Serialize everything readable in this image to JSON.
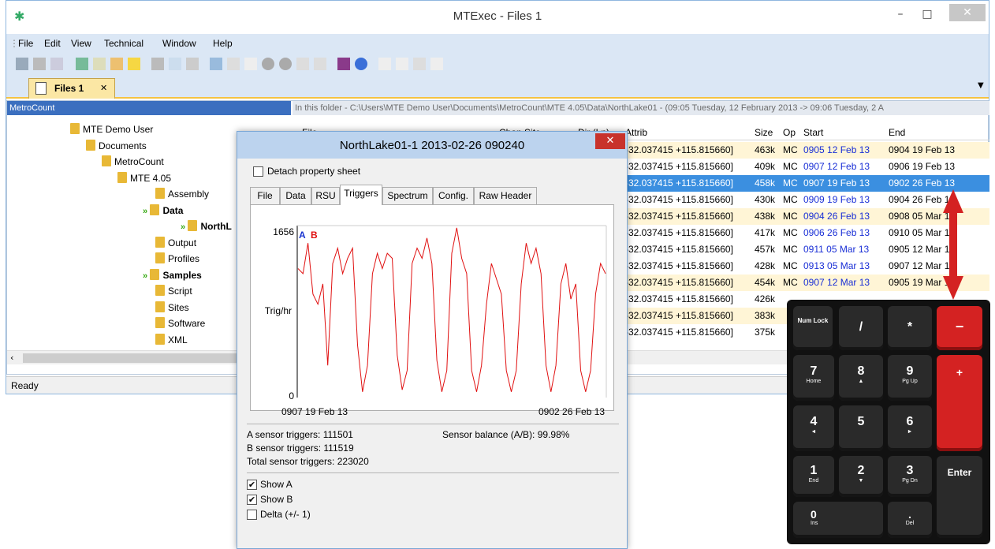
{
  "window": {
    "title": "MTExec - Files 1",
    "min": "–",
    "max": "□",
    "close": "✕"
  },
  "menu": [
    "File",
    "Edit",
    "View",
    "Technical",
    "Window",
    "Help"
  ],
  "tab": {
    "label": "Files 1",
    "close": "✕"
  },
  "tree": {
    "header": "MetroCount",
    "nodes": [
      "MTE Demo User",
      "Documents",
      "MetroCount",
      "MTE 4.05",
      "Assembly",
      "Data",
      "NorthL",
      "Output",
      "Profiles",
      "Samples",
      "Script",
      "Sites",
      "Software",
      "XML"
    ]
  },
  "list": {
    "path": "In this folder - C:\\Users\\MTE Demo User\\Documents\\MetroCount\\MTE 4.05\\Data\\NorthLake01 - (09:05 Tuesday, 12 February 2013 -> 09:06 Tuesday, 2 A",
    "columns": [
      "File",
      "Chan Site",
      "Dir (Ln)",
      "Attrib",
      "Size",
      "Op",
      "Start",
      "End"
    ],
    "rows": [
      {
        "attrib": "-32.037415 +115.815660]",
        "size": "463k",
        "op": "MC",
        "start": "0905 12 Feb 13",
        "end": "0904 19 Feb 13"
      },
      {
        "attrib": "-32.037415 +115.815660]",
        "size": "409k",
        "op": "MC",
        "start": "0907 12 Feb 13",
        "end": "0906 19 Feb 13"
      },
      {
        "attrib": "-32.037415 +115.815660]",
        "size": "458k",
        "op": "MC",
        "start": "0907 19 Feb 13",
        "end": "0902 26 Feb 13"
      },
      {
        "attrib": "-32.037415 +115.815660]",
        "size": "430k",
        "op": "MC",
        "start": "0909 19 Feb 13",
        "end": "0904 26 Feb 13"
      },
      {
        "attrib": "-32.037415 +115.815660]",
        "size": "438k",
        "op": "MC",
        "start": "0904 26 Feb 13",
        "end": "0908 05 Mar 13"
      },
      {
        "attrib": "-32.037415 +115.815660]",
        "size": "417k",
        "op": "MC",
        "start": "0906 26 Feb 13",
        "end": "0910 05 Mar 13"
      },
      {
        "attrib": "-32.037415 +115.815660]",
        "size": "457k",
        "op": "MC",
        "start": "0911 05 Mar 13",
        "end": "0905 12 Mar 13"
      },
      {
        "attrib": "-32.037415 +115.815660]",
        "size": "428k",
        "op": "MC",
        "start": "0913 05 Mar 13",
        "end": "0907 12 Mar 13"
      },
      {
        "attrib": "-32.037415 +115.815660]",
        "size": "454k",
        "op": "MC",
        "start": "0907 12 Mar 13",
        "end": "0905 19 Mar 13"
      },
      {
        "attrib": "-32.037415 +115.815660]",
        "size": "426k",
        "op": "",
        "start": "",
        "end": ""
      },
      {
        "attrib": "-32.037415 +115.815660]",
        "size": "383k",
        "op": "",
        "start": "",
        "end": ""
      },
      {
        "attrib": "-32.037415 +115.815660]",
        "size": "375k",
        "op": "",
        "start": "",
        "end": ""
      }
    ]
  },
  "status": "Ready",
  "dialog": {
    "title": "NorthLake01-1 2013-02-26 090240",
    "detach": "Detach property sheet",
    "close": "✕",
    "tabs": [
      "File",
      "Data",
      "RSU",
      "Triggers",
      "Spectrum",
      "Config.",
      "Raw Header"
    ],
    "a_trig": "A sensor triggers: 111501",
    "b_trig": "B sensor triggers: 111519",
    "total": "Total sensor triggers: 223020",
    "balance": "Sensor balance (A/B): 99.98%",
    "show_a": "Show A",
    "show_b": "Show B",
    "delta": "Delta (+/- 1)"
  },
  "chart_data": {
    "type": "line",
    "ylabel": "Trig/hr",
    "ylim": [
      0,
      1656
    ],
    "yticks": [
      "1656",
      "0"
    ],
    "xticks": [
      "0907 19 Feb 13",
      "0902 26 Feb 13"
    ],
    "legend": [
      "A",
      "B"
    ],
    "series": [
      {
        "name": "B",
        "color": "#e01010",
        "values": [
          1250,
          1200,
          1500,
          1000,
          900,
          1100,
          300,
          1300,
          1450,
          1200,
          1350,
          1450,
          500,
          40,
          300,
          1200,
          1400,
          1250,
          1400,
          1350,
          400,
          60,
          250,
          1300,
          1450,
          1350,
          1550,
          1300,
          350,
          40,
          250,
          1400,
          1650,
          1350,
          1200,
          250,
          40,
          300,
          900,
          1300,
          1150,
          1000,
          250,
          40,
          250,
          1100,
          1500,
          1300,
          1450,
          1200,
          300,
          40,
          300,
          1100,
          1300,
          950,
          1100,
          250,
          40,
          250,
          1000,
          1300,
          1200
        ]
      }
    ]
  },
  "keypad": {
    "numlock": "Num Lock",
    "slash": "/",
    "star": "*",
    "minus": "−",
    "plus": "+",
    "k7": "7",
    "k7s": "Home",
    "k8": "8",
    "k8s": "▲",
    "k9": "9",
    "k9s": "Pg Up",
    "k4": "4",
    "k4s": "◄",
    "k5": "5",
    "k6": "6",
    "k6s": "►",
    "k1": "1",
    "k1s": "End",
    "k2": "2",
    "k2s": "▼",
    "k3": "3",
    "k3s": "Pg Dn",
    "enter": "Enter",
    "k0": "0",
    "k0s": "Ins",
    "dot": ".",
    "dots": "Del"
  }
}
